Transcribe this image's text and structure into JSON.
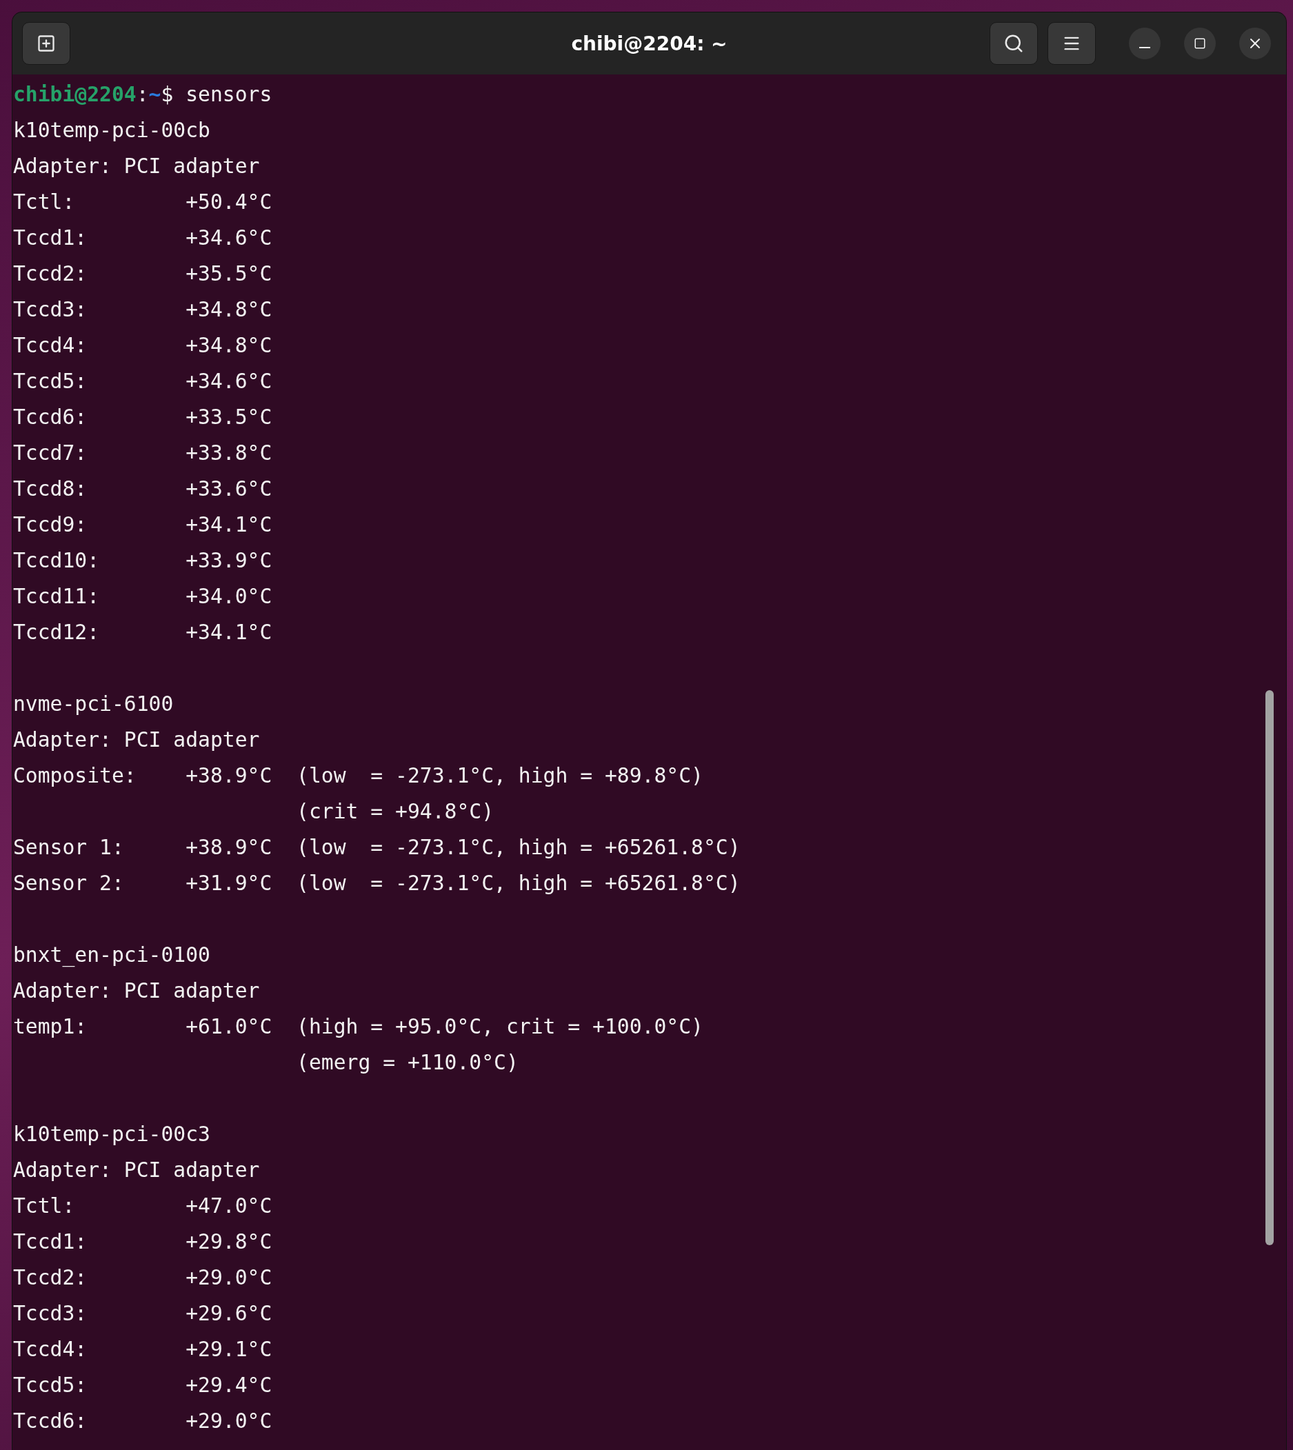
{
  "window": {
    "title": "chibi@2204: ~"
  },
  "lines": [
    {
      "kind": "prompt",
      "user_host": "chibi@2204",
      "separator": ":",
      "path": "~",
      "symbol": "$",
      "command": "sensors"
    },
    {
      "kind": "text",
      "text": "k10temp-pci-00cb"
    },
    {
      "kind": "text",
      "text": "Adapter: PCI adapter"
    },
    {
      "kind": "text",
      "text": "Tctl:         +50.4°C"
    },
    {
      "kind": "text",
      "text": "Tccd1:        +34.6°C"
    },
    {
      "kind": "text",
      "text": "Tccd2:        +35.5°C"
    },
    {
      "kind": "text",
      "text": "Tccd3:        +34.8°C"
    },
    {
      "kind": "text",
      "text": "Tccd4:        +34.8°C"
    },
    {
      "kind": "text",
      "text": "Tccd5:        +34.6°C"
    },
    {
      "kind": "text",
      "text": "Tccd6:        +33.5°C"
    },
    {
      "kind": "text",
      "text": "Tccd7:        +33.8°C"
    },
    {
      "kind": "text",
      "text": "Tccd8:        +33.6°C"
    },
    {
      "kind": "text",
      "text": "Tccd9:        +34.1°C"
    },
    {
      "kind": "text",
      "text": "Tccd10:       +33.9°C"
    },
    {
      "kind": "text",
      "text": "Tccd11:       +34.0°C"
    },
    {
      "kind": "text",
      "text": "Tccd12:       +34.1°C"
    },
    {
      "kind": "blank"
    },
    {
      "kind": "text",
      "text": "nvme-pci-6100"
    },
    {
      "kind": "text",
      "text": "Adapter: PCI adapter"
    },
    {
      "kind": "text",
      "text": "Composite:    +38.9°C  (low  = -273.1°C, high = +89.8°C)"
    },
    {
      "kind": "text",
      "text": "                       (crit = +94.8°C)"
    },
    {
      "kind": "text",
      "text": "Sensor 1:     +38.9°C  (low  = -273.1°C, high = +65261.8°C)"
    },
    {
      "kind": "text",
      "text": "Sensor 2:     +31.9°C  (low  = -273.1°C, high = +65261.8°C)"
    },
    {
      "kind": "blank"
    },
    {
      "kind": "text",
      "text": "bnxt_en-pci-0100"
    },
    {
      "kind": "text",
      "text": "Adapter: PCI adapter"
    },
    {
      "kind": "text",
      "text": "temp1:        +61.0°C  (high = +95.0°C, crit = +100.0°C)"
    },
    {
      "kind": "text",
      "text": "                       (emerg = +110.0°C)"
    },
    {
      "kind": "blank"
    },
    {
      "kind": "text",
      "text": "k10temp-pci-00c3"
    },
    {
      "kind": "text",
      "text": "Adapter: PCI adapter"
    },
    {
      "kind": "text",
      "text": "Tctl:         +47.0°C"
    },
    {
      "kind": "text",
      "text": "Tccd1:        +29.8°C"
    },
    {
      "kind": "text",
      "text": "Tccd2:        +29.0°C"
    },
    {
      "kind": "text",
      "text": "Tccd3:        +29.6°C"
    },
    {
      "kind": "text",
      "text": "Tccd4:        +29.1°C"
    },
    {
      "kind": "text",
      "text": "Tccd5:        +29.4°C"
    },
    {
      "kind": "text",
      "text": "Tccd6:        +29.0°C"
    }
  ]
}
